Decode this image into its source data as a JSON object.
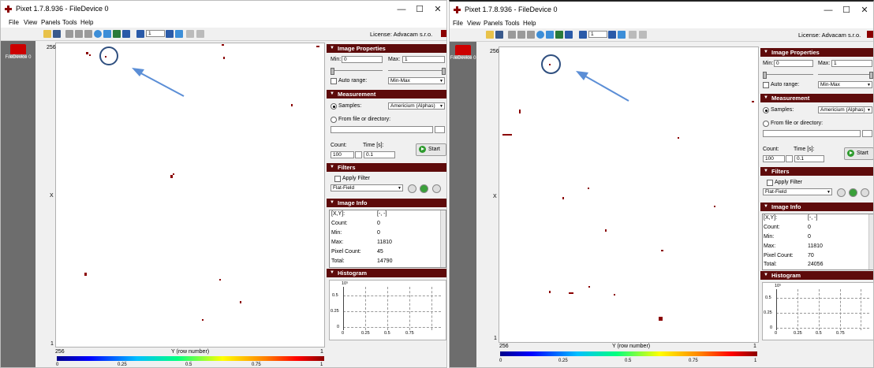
{
  "windows": [
    {
      "title": "Pixet 1.7.8.936 - FileDevice 0",
      "controls": {
        "minimize": "—",
        "maximize": "☐",
        "close": "✕"
      },
      "menu": [
        "File",
        "View",
        "Panels",
        "Tools",
        "Help"
      ],
      "toolbar": {
        "page_value": "1",
        "license": "License: Advacam s.r.o."
      },
      "device": {
        "label": "FileDevice 0"
      },
      "image": {
        "y_top": "256",
        "y_bottom": "1",
        "x_label": "X",
        "colorbar_left": "256",
        "colorbar_title": "Y (row number)",
        "colorbar_right": "1",
        "cb_ticks": [
          "0",
          "0.25",
          "0.5",
          "0.75",
          "1"
        ]
      },
      "image_properties": {
        "header": "Image Properties",
        "min_label": "Min:",
        "min_value": "0",
        "max_label": "Max:",
        "max_value": "1",
        "auto_range_label": "Auto range:",
        "auto_range_value": "Min-Max"
      },
      "measurement": {
        "header": "Measurement",
        "samples_label": "Samples:",
        "samples_value": "Americium (Alphas)",
        "from_file_label": "From file or directory:",
        "count_label": "Count:",
        "count_value": "100",
        "time_label": "Time [s]:",
        "time_value": "0.1",
        "start_label": "Start"
      },
      "filters": {
        "header": "Filters",
        "apply_label": "Apply Filter",
        "filter_value": "Flat-Field"
      },
      "image_info": {
        "header": "Image Info",
        "rows": [
          {
            "k": "[X,Y]:",
            "v": "[-, -]"
          },
          {
            "k": "Count:",
            "v": "0"
          },
          {
            "k": "Min:",
            "v": "0"
          },
          {
            "k": "Max:",
            "v": "11810"
          },
          {
            "k": "Pixel Count:",
            "v": "45"
          },
          {
            "k": "Total:",
            "v": "14790"
          }
        ]
      },
      "histogram": {
        "header": "Histogram",
        "y_exp": "10⁵",
        "y_ticks": [
          "0.5",
          "0.25",
          "0"
        ],
        "x_ticks": [
          "0",
          "0.25",
          "0.5",
          "0.75"
        ]
      }
    },
    {
      "title": "Pixet 1.7.8.936 - FileDevice 0",
      "controls": {
        "minimize": "—",
        "maximize": "☐",
        "close": "✕"
      },
      "menu": [
        "File",
        "View",
        "Panels",
        "Tools",
        "Help"
      ],
      "toolbar": {
        "page_value": "1",
        "license": "License: Advacam s.r.o."
      },
      "device": {
        "label": "FileDevice 0"
      },
      "image": {
        "y_top": "256",
        "y_bottom": "1",
        "x_label": "X",
        "colorbar_left": "256",
        "colorbar_title": "Y (row number)",
        "colorbar_right": "1",
        "cb_ticks": [
          "0",
          "0.25",
          "0.5",
          "0.75",
          "1"
        ]
      },
      "image_properties": {
        "header": "Image Properties",
        "min_label": "Min:",
        "min_value": "0",
        "max_label": "Max:",
        "max_value": "1",
        "auto_range_label": "Auto range:",
        "auto_range_value": "Min-Max"
      },
      "measurement": {
        "header": "Measurement",
        "samples_label": "Samples:",
        "samples_value": "Americium (Alphas)",
        "from_file_label": "From file or directory:",
        "count_label": "Count:",
        "count_value": "100",
        "time_label": "Time [s]:",
        "time_value": "0.1",
        "start_label": "Start"
      },
      "filters": {
        "header": "Filters",
        "apply_label": "Apply Filter",
        "filter_value": "Flat-Field"
      },
      "image_info": {
        "header": "Image Info",
        "rows": [
          {
            "k": "[X,Y]:",
            "v": "[-, -]"
          },
          {
            "k": "Count:",
            "v": "0"
          },
          {
            "k": "Min:",
            "v": "0"
          },
          {
            "k": "Max:",
            "v": "11810"
          },
          {
            "k": "Pixel Count:",
            "v": "70"
          },
          {
            "k": "Total:",
            "v": "24056"
          }
        ]
      },
      "histogram": {
        "header": "Histogram",
        "y_exp": "10⁵",
        "y_ticks": [
          "0.5",
          "0.25",
          "0"
        ],
        "x_ticks": [
          "0",
          "0.25",
          "0.5",
          "0.75"
        ]
      }
    }
  ]
}
